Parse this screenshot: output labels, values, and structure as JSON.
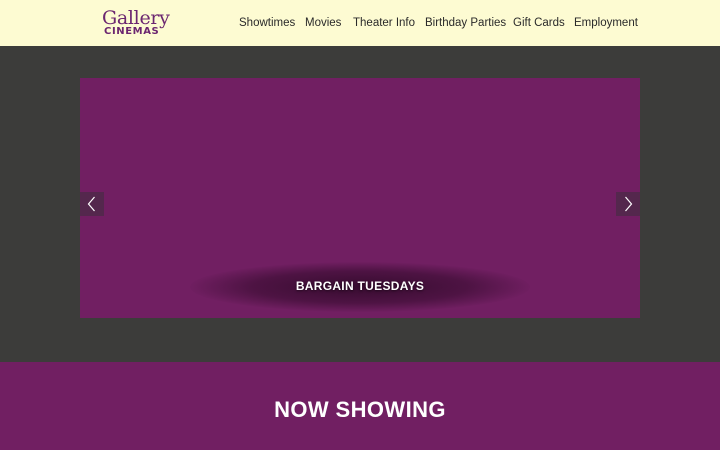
{
  "logo": {
    "script": "Gallery",
    "block": "CINEMAS"
  },
  "nav": {
    "items": [
      {
        "label": "Showtimes"
      },
      {
        "label": "Movies"
      },
      {
        "label": "Theater Info"
      },
      {
        "label": "Birthday Parties"
      },
      {
        "label": "Gift Cards"
      },
      {
        "label": "Employment"
      }
    ]
  },
  "slider": {
    "caption": "BARGAIN TUESDAYS",
    "prev_icon": "chevron-left-icon",
    "next_icon": "chevron-right-icon"
  },
  "now_showing": {
    "title": "NOW SHOWING"
  },
  "colors": {
    "header_bg": "#fdfbd2",
    "brand_purple": "#711f62",
    "logo_purple": "#6b2670",
    "dark_bg": "#3c3c3a"
  }
}
